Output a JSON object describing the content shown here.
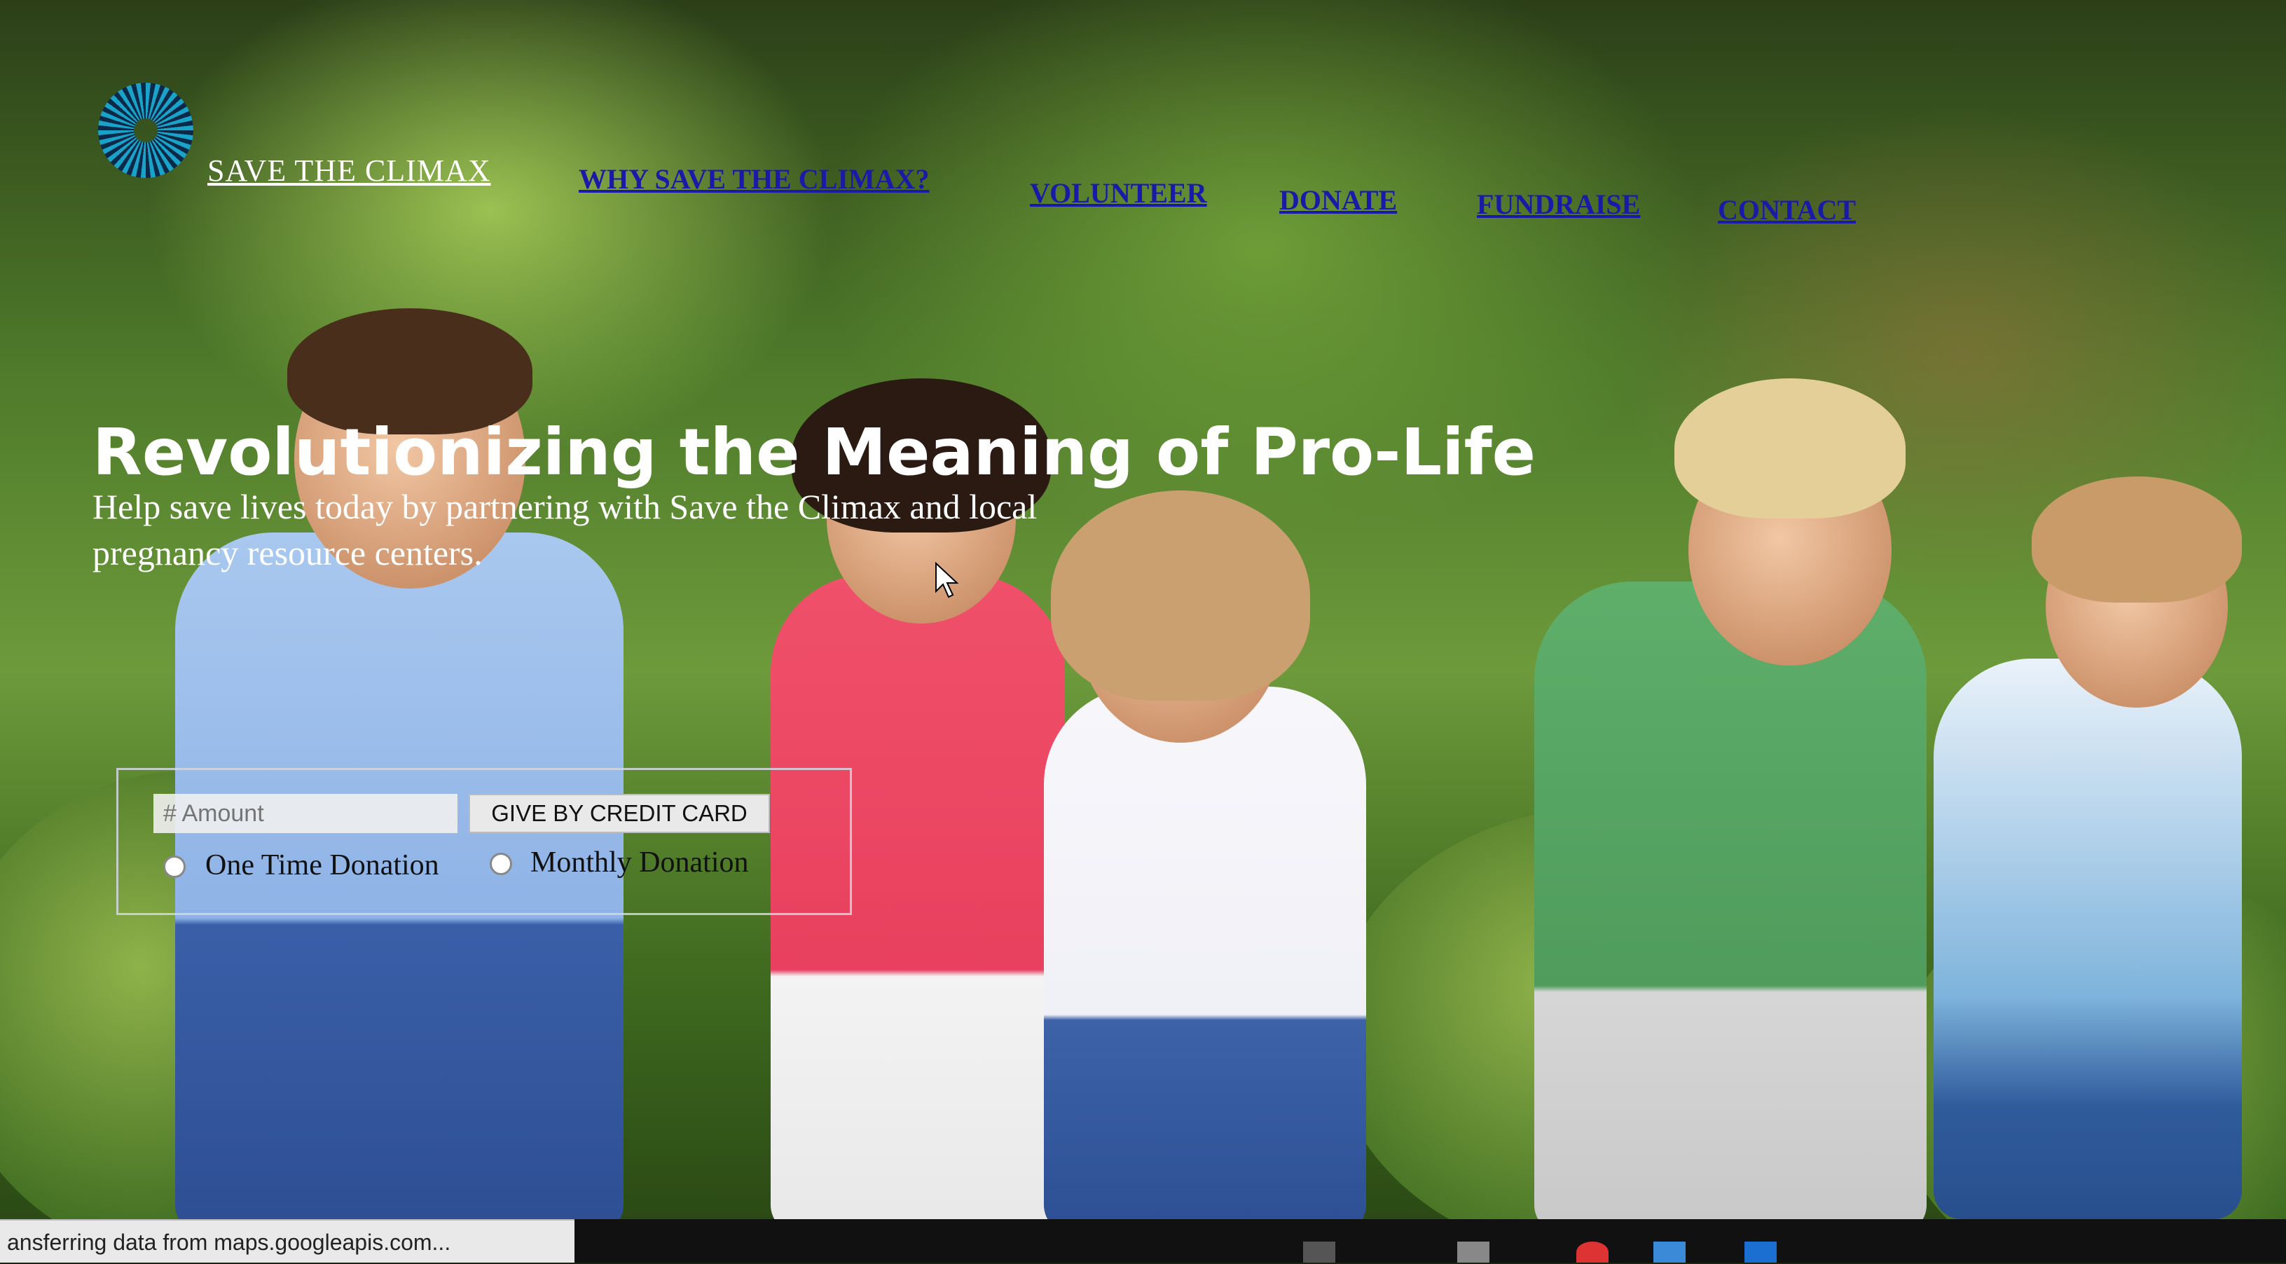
{
  "brand": {
    "name": "SAVE THE CLIMAX"
  },
  "nav": {
    "items": [
      "WHY SAVE THE CLIMAX?",
      "VOLUNTEER",
      "DONATE",
      "FUNDRAISE",
      "CONTACT"
    ]
  },
  "hero": {
    "headline": "Revolutionizing the Meaning of Pro-Life",
    "subtext": "Help save lives today by partnering with Save the Climax and local pregnancy resource centers."
  },
  "donation_form": {
    "amount_placeholder": "# Amount",
    "amount_value": "",
    "give_button": "GIVE BY CREDIT CARD",
    "one_time_label": "One Time Donation",
    "monthly_label": "Monthly Donation",
    "selected_frequency": "none"
  },
  "status_bar": {
    "text": "ansferring data from maps.googleapis.com..."
  },
  "colors": {
    "nav_link": "#1a1aa8",
    "brand_text": "#ffffff",
    "logo_accent": "#1aa3c9"
  }
}
